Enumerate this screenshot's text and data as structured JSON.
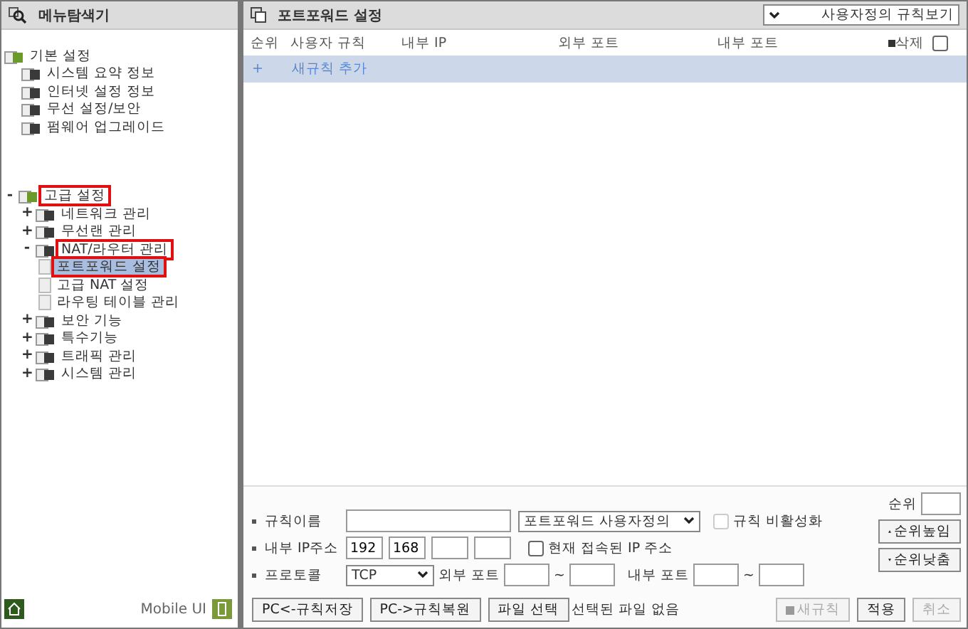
{
  "sidebar": {
    "title": "메뉴탐색기",
    "footer_label": "Mobile UI",
    "tree": [
      {
        "label": "기본 설정",
        "highlighted": false,
        "selected": false,
        "children": [
          {
            "label": "시스템 요약 정보",
            "highlighted": false,
            "selected": false
          },
          {
            "label": "인터넷 설정 정보",
            "highlighted": false,
            "selected": false
          },
          {
            "label": "무선 설정/보안",
            "highlighted": false,
            "selected": false
          },
          {
            "label": "펌웨어 업그레이드",
            "highlighted": false,
            "selected": false
          }
        ]
      },
      {
        "label": "고급 설정",
        "expander": "-",
        "highlighted": true,
        "selected": false,
        "children": [
          {
            "label": "네트워크 관리",
            "expander": "+",
            "highlighted": false,
            "selected": false
          },
          {
            "label": "무선랜 관리",
            "expander": "+",
            "highlighted": false,
            "selected": false
          },
          {
            "label": "NAT/라우터 관리",
            "expander": "-",
            "highlighted": true,
            "selected": false,
            "children": [
              {
                "label": "포트포워드 설정",
                "highlighted": true,
                "selected": true
              },
              {
                "label": "고급 NAT 설정",
                "highlighted": false,
                "selected": false
              },
              {
                "label": "라우팅 테이블 관리",
                "highlighted": false,
                "selected": false
              }
            ]
          },
          {
            "label": "보안 기능",
            "expander": "+",
            "highlighted": false,
            "selected": false
          },
          {
            "label": "특수기능",
            "expander": "+",
            "highlighted": false,
            "selected": false
          },
          {
            "label": "트래픽 관리",
            "expander": "+",
            "highlighted": false,
            "selected": false
          },
          {
            "label": "시스템 관리",
            "expander": "+",
            "highlighted": false,
            "selected": false
          }
        ]
      }
    ]
  },
  "panel": {
    "title": "포트포워드 설정",
    "view_select": "사용자정의 규칙보기",
    "columns": [
      "순위",
      "사용자 규칙",
      "내부 IP",
      "외부 포트",
      "내부 포트"
    ],
    "delete_label": "삭제",
    "delete_checked": false,
    "add_row": {
      "icon": "+",
      "label": "새규칙 추가"
    }
  },
  "form": {
    "name": {
      "label": "규칙이름",
      "type_select": "포트포워드 사용자정의",
      "disable_label": "규칙 비활성화",
      "disable_checked": false
    },
    "ip": {
      "label": "내부 IP주소",
      "octets": [
        "192",
        "168"
      ],
      "current_label": "현재 접속된 IP 주소",
      "current_checked": false
    },
    "protocol": {
      "label": "프로토콜",
      "value": "TCP",
      "ext_label": "외부 포트",
      "int_label": "내부 포트",
      "sep": "~"
    },
    "order": {
      "label": "순위",
      "up": "순위높임",
      "down": "순위낮춤"
    },
    "buttons": [
      {
        "label": "PC<-규칙저장",
        "disabled": false
      },
      {
        "label": "PC->규칙복원",
        "disabled": false
      },
      {
        "label": "파일 선택",
        "disabled": false
      }
    ],
    "file_status": "선택된 파일 없음",
    "actions": [
      {
        "label": "새규칙",
        "disabled": true,
        "icon": true
      },
      {
        "label": "적용",
        "disabled": false,
        "icon": false
      },
      {
        "label": "취소",
        "disabled": true,
        "icon": false
      }
    ]
  }
}
